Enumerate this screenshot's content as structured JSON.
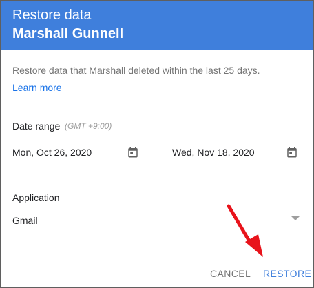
{
  "dialog": {
    "title": "Restore data",
    "user_name": "Marshall Gunnell",
    "description": "Restore data that Marshall deleted within the last 25 days.",
    "learn_more": "Learn more",
    "date_range": {
      "label": "Date range",
      "timezone": "(GMT +9:00)",
      "start": "Mon, Oct 26, 2020",
      "end": "Wed, Nov 18, 2020"
    },
    "application": {
      "label": "Application",
      "selected": "Gmail"
    },
    "actions": {
      "cancel": "CANCEL",
      "restore": "RESTORE"
    }
  },
  "colors": {
    "header": "#3f7fdc",
    "link": "#1a73e8",
    "annotation_arrow": "#e8131b"
  },
  "icons": {
    "date_picker": "calendar-icon",
    "dropdown": "dropdown-arrow-icon",
    "annotation": "red-arrow-pointer"
  }
}
